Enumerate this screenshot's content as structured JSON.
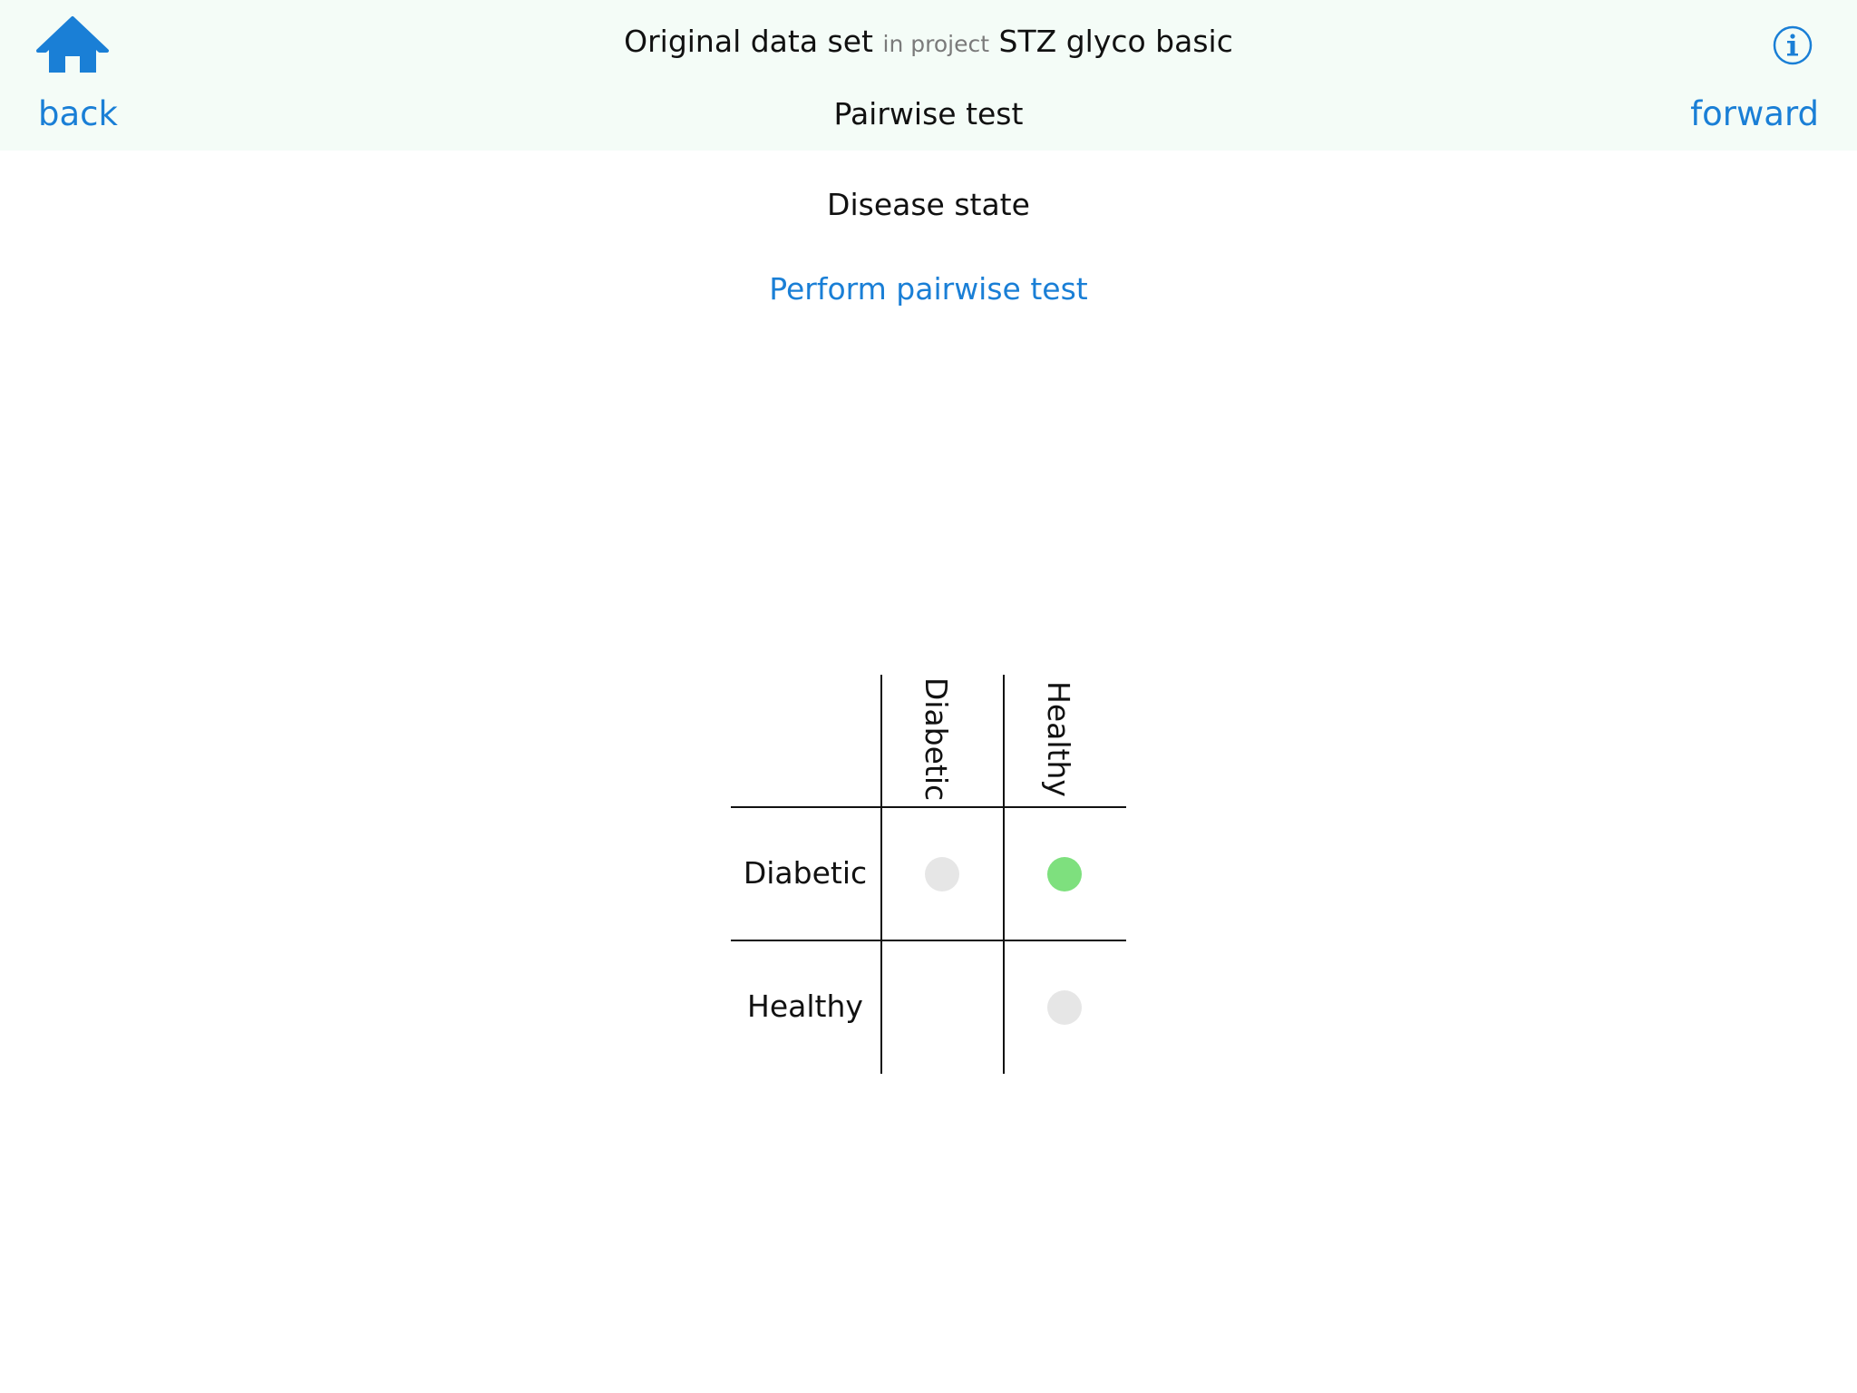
{
  "header": {
    "title_main": "Original data set",
    "title_sep": "in project",
    "title_project": "STZ glyco basic",
    "subtitle": "Pairwise test",
    "back_label": "back",
    "forward_label": "forward",
    "home_icon": "home-icon",
    "info_icon": "info-icon"
  },
  "content": {
    "factor": "Disease state",
    "perform_label": "Perform pairwise test"
  },
  "matrix": {
    "columns": [
      "Diabetic",
      "Healthy"
    ],
    "rows": [
      "Diabetic",
      "Healthy"
    ],
    "cells": [
      [
        {
          "state": "neutral"
        },
        {
          "state": "significant"
        }
      ],
      [
        null,
        {
          "state": "neutral"
        }
      ]
    ]
  },
  "colors": {
    "accent": "#1a7fd6",
    "header_bg": "#f4fcf7",
    "neutral_dot": "#e6e6e6",
    "significant_dot": "#7ee07e"
  }
}
